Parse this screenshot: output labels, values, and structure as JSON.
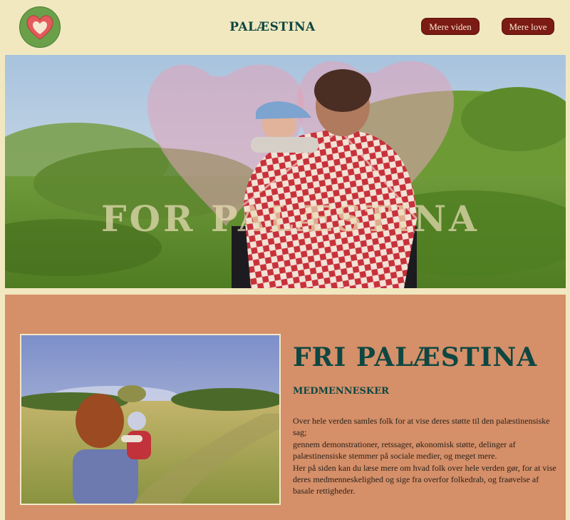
{
  "header": {
    "logo_icon": "heart-icon",
    "brand": "PALÆSTINA",
    "nav": [
      {
        "label": "Mere viden"
      },
      {
        "label": "Mere love"
      }
    ]
  },
  "hero": {
    "title": "FOR PALÆSTINA"
  },
  "section": {
    "title": "FRI PALÆSTINA",
    "subtitle": "MEDMENNESKER",
    "paragraph": [
      "Over hele verden samles folk for at vise deres støtte til den palæstinensiske sag;",
      "gennem demonstrationer, retssager, økonomisk støtte, delinger af palæstinensiske stemmer på sociale medier, og meget mere.",
      "Her på siden kan du læse mere om hvad folk over hele verden gør, for at vise deres medmenneskelighed og sige fra overfor folkedrab, og fraøvelse af basale rettigheder."
    ]
  },
  "colors": {
    "background": "#f1e8c0",
    "accent": "#7c1a14",
    "heading": "#0e4741",
    "section_bg": "#d58f69"
  }
}
